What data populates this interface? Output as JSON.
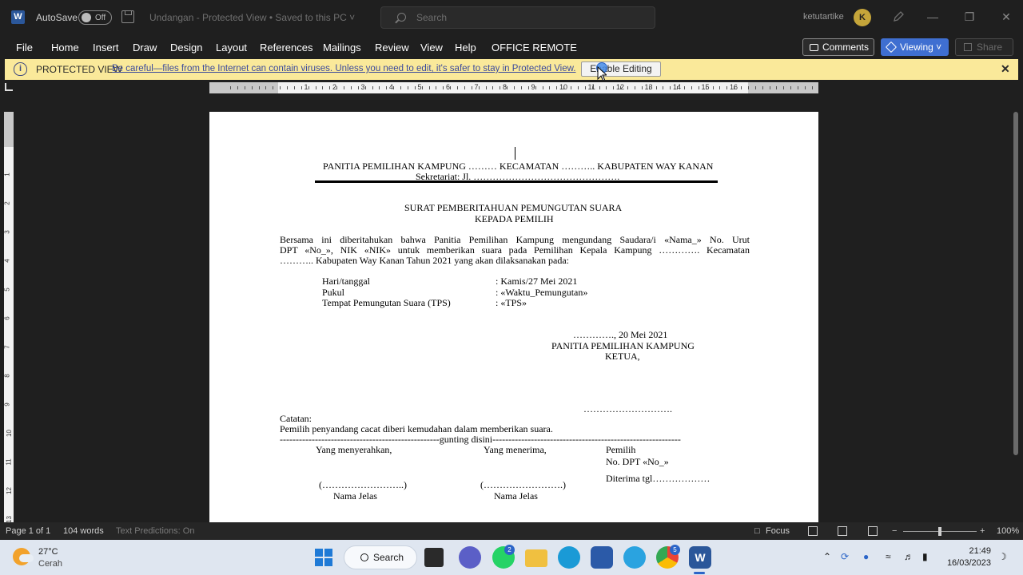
{
  "titlebar": {
    "autosave_label": "AutoSave",
    "autosave_state": "Off",
    "document_title": "Undangan - Protected View • Saved to this PC ˅",
    "search_placeholder": "Search",
    "user_name": "ketutartike",
    "avatar_initial": "K"
  },
  "menu": {
    "items": [
      "File",
      "Home",
      "Insert",
      "Draw",
      "Design",
      "Layout",
      "References",
      "Mailings",
      "Review",
      "View",
      "Help",
      "OFFICE REMOTE"
    ],
    "comments": "Comments",
    "viewing": "Viewing ˅",
    "share": "Share"
  },
  "protected_view": {
    "title": "PROTECTED VIEW",
    "message": "Be careful—files from the Internet can contain viruses. Unless you need to edit, it's safer to stay in Protected View.",
    "button": "Enable Editing"
  },
  "ruler": {
    "numbers": [
      "1",
      "2",
      "3",
      "4",
      "5",
      "6",
      "7",
      "8",
      "9",
      "10",
      "11",
      "12",
      "13",
      "14",
      "15",
      "16"
    ]
  },
  "document": {
    "header_line1": "PANITIA PEMILIHAN KAMPUNG ……… KECAMATAN ……….. KABUPATEN WAY KANAN",
    "header_line2": "Sekretariat: Jl. ……………………………………….",
    "title1": "SURAT PEMBERITAHUAN PEMUNGUTAN SUARA",
    "title2": "KEPADA PEMILIH",
    "para_line1": "Bersama ini diberitahukan bahwa Panitia Pemilihan Kampung mengundang Saudara/i «Nama_» No. Urut",
    "para_line2": "DPT «No_», NIK «NIK» untuk memberikan suara pada Pemilihan Kepala Kampung …………. Kecamatan",
    "para_line3": "……….. Kabupaten Way Kanan Tahun 2021 yang akan dilaksanakan pada:",
    "details": [
      {
        "label": "Hari/tanggal",
        "value": ": Kamis/27 Mei 2021"
      },
      {
        "label": "Pukul",
        "value": ": «Waktu_Pemungutan»"
      },
      {
        "label": "Tempat Pemungutan Suara (TPS)",
        "value": ": «TPS»"
      }
    ],
    "date_line": "…………., 20 Mei 2021",
    "committee": "PANITIA PEMILIHAN KAMPUNG",
    "chair": "KETUA,",
    "signature_dots": "……………………….",
    "note_label": "Catatan:",
    "note_text": "Pemilih penyandang cacat diberi kemudahan dalam memberikan suara.",
    "cut_line": "--------------------------------------------------gunting disini-----------------------------------------------------------",
    "sender": "Yang menyerahkan,",
    "receiver": "Yang menerima,",
    "voter": "Pemilih",
    "voter_dpt": "No. DPT «No_»",
    "received_date": "Diterima tgl………………",
    "sign1": "(……………………..)",
    "sign2": "(…………………….)",
    "name1": "Nama Jelas",
    "name2": "Nama Jelas"
  },
  "statusbar": {
    "page": "Page 1 of 1",
    "words": "104 words",
    "predictions": "Text Predictions: On",
    "focus": "Focus",
    "zoom": "100%"
  },
  "taskbar": {
    "temperature": "27°C",
    "weather": "Cerah",
    "search": "Search",
    "whatsapp_badge": "2",
    "chrome_badge": "5",
    "time": "21:49",
    "date": "16/03/2023"
  }
}
